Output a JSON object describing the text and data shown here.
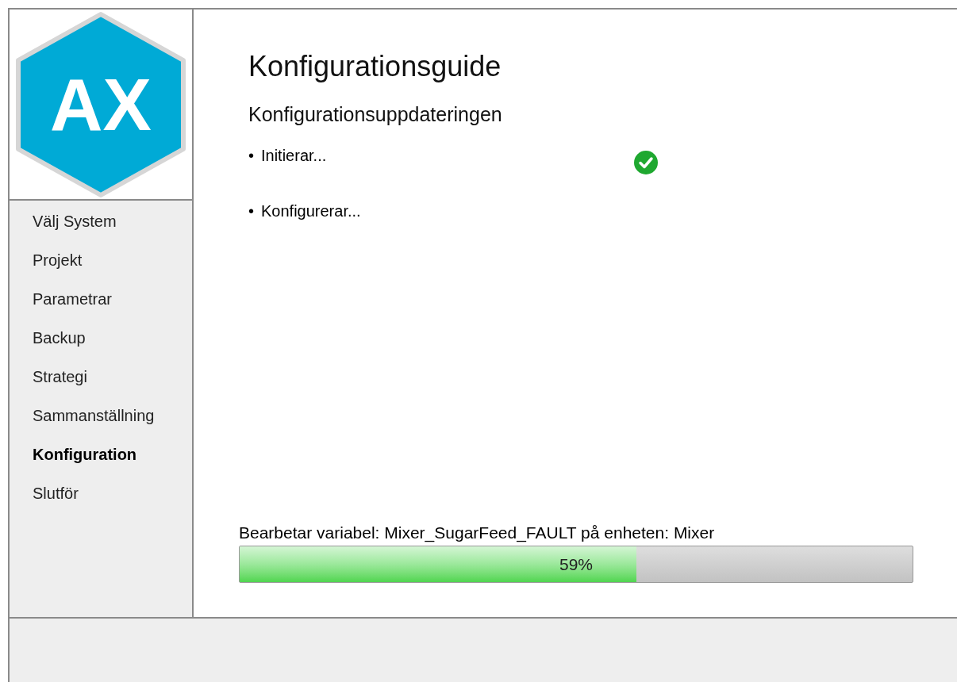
{
  "logo": {
    "text": "AX"
  },
  "sidebar": {
    "items": [
      {
        "label": "Välj System",
        "selected": false
      },
      {
        "label": "Projekt",
        "selected": false
      },
      {
        "label": "Parametrar",
        "selected": false
      },
      {
        "label": "Backup",
        "selected": false
      },
      {
        "label": "Strategi",
        "selected": false
      },
      {
        "label": "Sammanställning",
        "selected": false
      },
      {
        "label": "Konfiguration",
        "selected": true
      },
      {
        "label": "Slutför",
        "selected": false
      }
    ]
  },
  "title": "Konfigurationsguide",
  "subtitle": "Konfigurationsuppdateringen",
  "steps": [
    {
      "bullet": "•",
      "label": "Initierar...",
      "done": true
    },
    {
      "bullet": "•",
      "label": "Konfigurerar...",
      "done": false
    }
  ],
  "status": "Bearbetar variabel: Mixer_SugarFeed_FAULT på enheten: Mixer",
  "progress": {
    "level": 0.59,
    "reading": "59%"
  }
}
